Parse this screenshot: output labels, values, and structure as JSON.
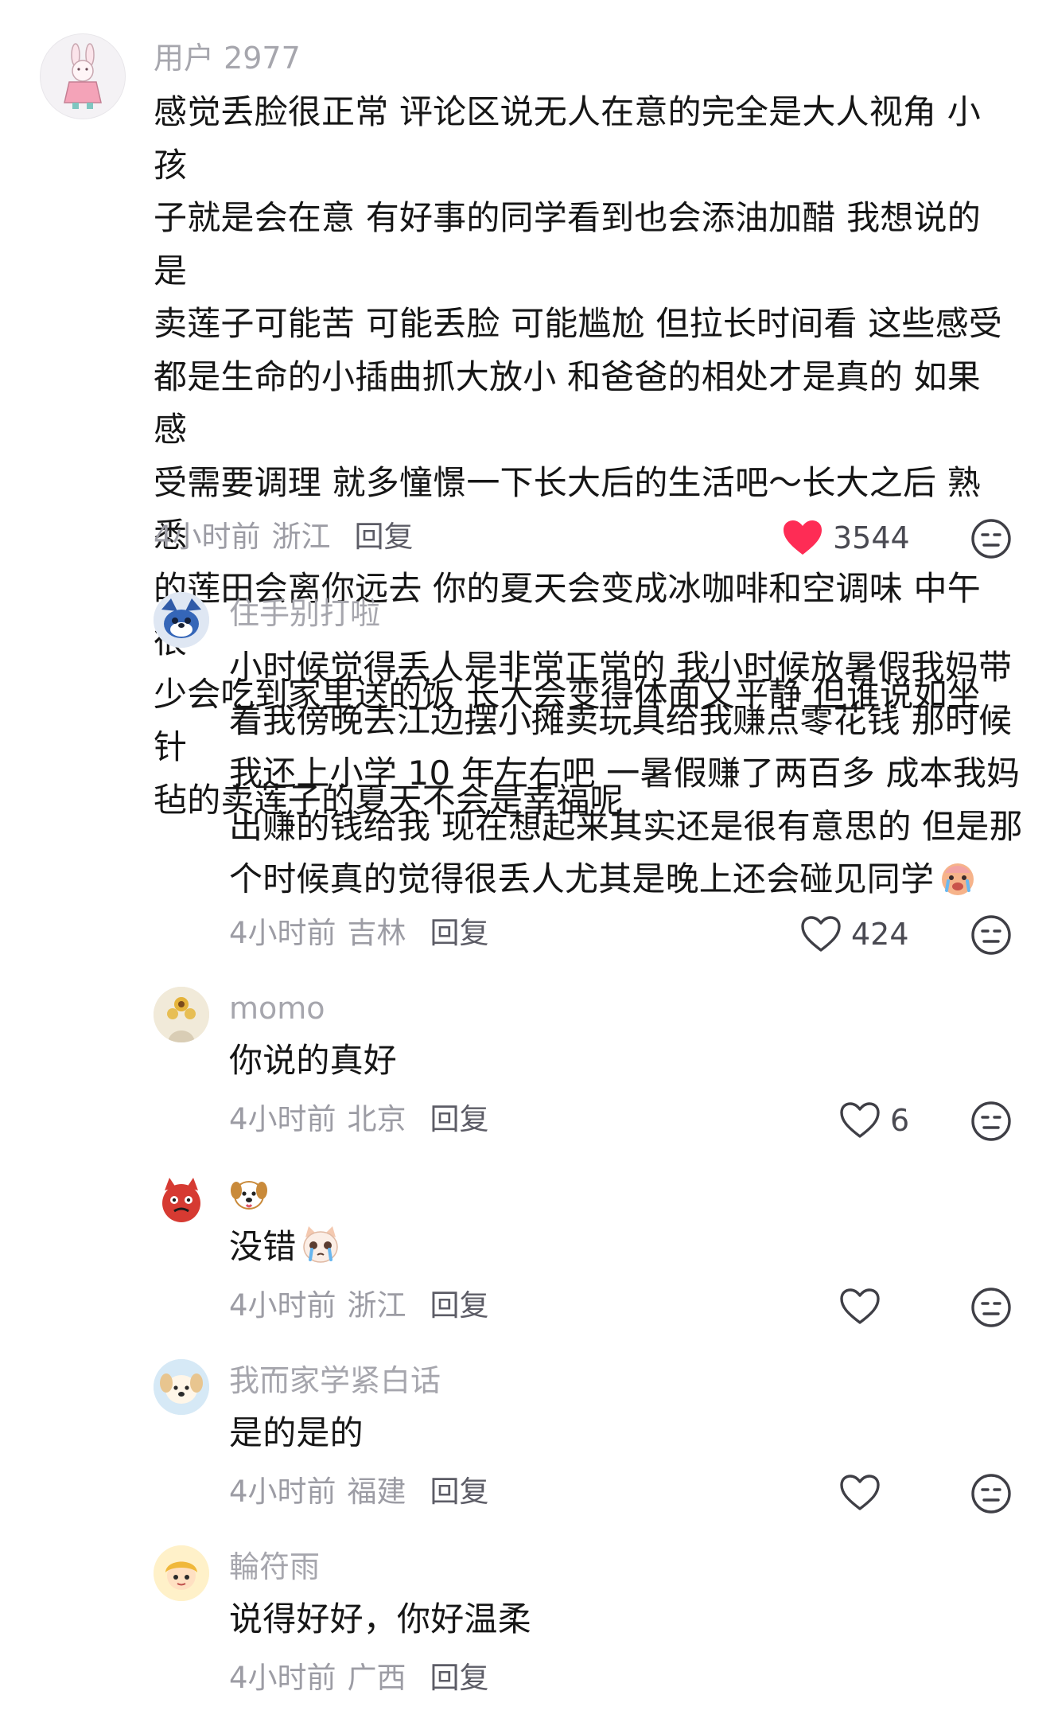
{
  "comments": [
    {
      "username": "用户 2977",
      "text": "感觉丢脸很正常 评论区说无人在意的完全是大人视角 小孩\n子就是会在意 有好事的同学看到也会添油加醋 我想说的是\n卖莲子可能苦 可能丢脸 可能尴尬 但拉长时间看 这些感受\n都是生命的小插曲抓大放小 和爸爸的相处才是真的 如果感\n受需要调理 就多憧憬一下长大后的生活吧～长大之后 熟悉\n的莲田会离你远去 你的夏天会变成冰咖啡和空调味 中午很\n少会吃到家里送的饭 长大会变得体面又平静 但谁说如坐针\n毡的卖莲子的夏天不会是幸福呢",
      "time": "4小时前",
      "location": "浙江",
      "reply": "回复",
      "likes": "3544",
      "liked": true
    },
    {
      "username": "住手别打啦",
      "text": "小时候觉得丢人是非常正常的 我小时候放暑假我妈带\n着我傍晚去江边摆小摊卖玩具给我赚点零花钱 那时候\n我还上小学 10 年左右吧 一暑假赚了两百多 成本我妈\n出赚的钱给我 现在想起来其实还是很有意思的 但是那\n个时候真的觉得很丢人尤其是晚上还会碰见同学",
      "time": "4小时前",
      "location": "吉林",
      "reply": "回复",
      "likes": "424",
      "liked": false
    },
    {
      "username": "momo",
      "text": "你说的真好",
      "time": "4小时前",
      "location": "北京",
      "reply": "回复",
      "likes": "6",
      "liked": false
    },
    {
      "username": "🐶",
      "text": "没错",
      "time": "4小时前",
      "location": "浙江",
      "reply": "回复",
      "likes": "",
      "liked": false
    },
    {
      "username": "我而家学紧白话",
      "text": "是的是的",
      "time": "4小时前",
      "location": "福建",
      "reply": "回复",
      "likes": "",
      "liked": false
    },
    {
      "username": "輪符雨",
      "text": "说得好好，你好温柔",
      "time": "4小时前",
      "location": "广西",
      "reply": "回复",
      "likes": "",
      "liked": false
    }
  ],
  "colors": {
    "heart_active": "#fe2c55",
    "meta_text": "#9c9ca4",
    "username": "#a6a6ad"
  },
  "icons": [
    "heart-icon",
    "dislike-face-icon",
    "crying-emoji-icon",
    "crying-cat-emoji-icon",
    "dog-emoji-icon"
  ]
}
